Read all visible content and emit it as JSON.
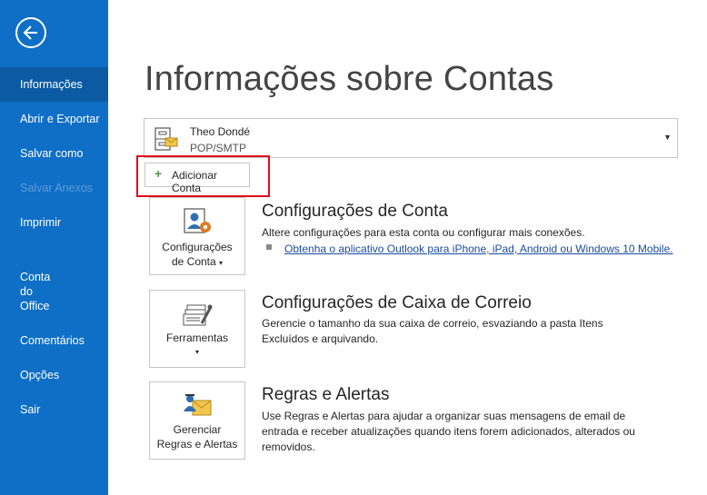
{
  "sidebar": {
    "back_icon": "back-arrow-icon",
    "items": [
      {
        "label": "Informações",
        "state": "active"
      },
      {
        "label": "Abrir e Exportar",
        "state": "normal"
      },
      {
        "label": "Salvar como",
        "state": "normal"
      },
      {
        "label": "Salvar Anexos",
        "state": "disabled"
      },
      {
        "label": "Imprimir",
        "state": "normal"
      },
      {
        "label": "Conta\ndo\nOffice",
        "state": "normal"
      },
      {
        "label": "Comentários",
        "state": "normal"
      },
      {
        "label": "Opções",
        "state": "normal"
      },
      {
        "label": "Sair",
        "state": "normal"
      }
    ]
  },
  "main": {
    "title": "Informações sobre Contas",
    "account": {
      "name": "Theo Dondé",
      "type": "POP/SMTP",
      "icon": "mailbox-icon"
    },
    "add_account_label": "Adicionar Conta",
    "sections": [
      {
        "tile_label_1": "Configurações",
        "tile_label_2": "de Conta",
        "tile_icon": "account-settings-icon",
        "title": "Configurações de Conta",
        "description": "Altere configurações para esta conta ou configurar mais conexões.",
        "link": "Obtenha o aplicativo Outlook para iPhone, iPad, Android ou Windows 10 Mobile."
      },
      {
        "tile_label_1": "Ferramentas",
        "tile_icon": "tools-icon",
        "title": "Configurações de Caixa de Correio",
        "description": "Gerencie o tamanho da sua caixa de correio, esvaziando a pasta Itens Excluídos e arquivando."
      },
      {
        "tile_label_1": "Gerenciar",
        "tile_label_2": "Regras e Alertas",
        "tile_icon": "rules-alerts-icon",
        "title": "Regras e Alertas",
        "description": "Use Regras e Alertas para ajudar a organizar suas mensagens de email de entrada e receber atualizações quando itens forem adicionados, alterados ou removidos."
      }
    ]
  },
  "colors": {
    "sidebar_bg": "#0f6fc6",
    "sidebar_active": "#0b5aa3",
    "highlight_border": "#e10d1a",
    "link": "#1a4b9e"
  }
}
